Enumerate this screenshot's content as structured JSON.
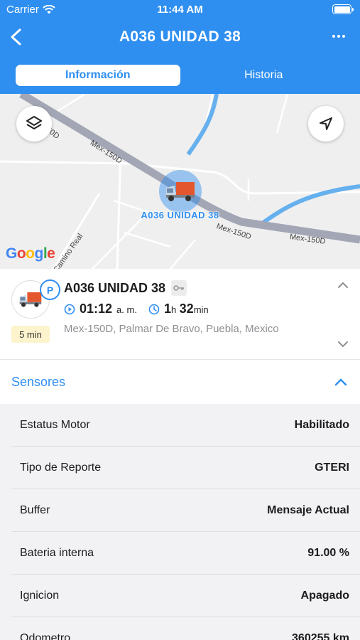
{
  "status_bar": {
    "carrier": "Carrier",
    "time": "11:44 AM"
  },
  "nav": {
    "title": "A036 UNIDAD 38"
  },
  "tabs": [
    {
      "label": "Información",
      "active": true
    },
    {
      "label": "Historia",
      "active": false
    }
  ],
  "map": {
    "marker_label": "A036 UNIDAD 38",
    "road_labels": [
      "Mex-150D",
      "Mex-150D",
      "Mex-150D",
      "Mex-150D",
      "Mex-150D",
      "Camino Real"
    ],
    "attribution": "Google"
  },
  "vehicle": {
    "name": "A036 UNIDAD 38",
    "status_badge": "P",
    "time_ago": "5 min",
    "time_main": "01:12",
    "time_suffix": "a. m.",
    "duration_hours": "1",
    "duration_h_unit": "h",
    "duration_minutes": "32",
    "duration_min_unit": "min",
    "address": "Mex-150D, Palmar De Bravo, Puebla, Mexico"
  },
  "sensores": {
    "title": "Sensores",
    "rows": [
      {
        "label": "Estatus Motor",
        "value": "Habilitado"
      },
      {
        "label": "Tipo de Reporte",
        "value": "GTERI"
      },
      {
        "label": "Buffer",
        "value": "Mensaje Actual"
      },
      {
        "label": "Bateria interna",
        "value": "91.00 %"
      },
      {
        "label": "Ignicion",
        "value": "Apagado"
      },
      {
        "label": "Odometro",
        "value": "360255 km"
      }
    ]
  },
  "colors": {
    "accent": "#2f8ff0",
    "time_ago_bg": "#fdf3cc",
    "map_bg": "#efefef",
    "road": "#a2a6b5",
    "water": "#66b0ee"
  }
}
